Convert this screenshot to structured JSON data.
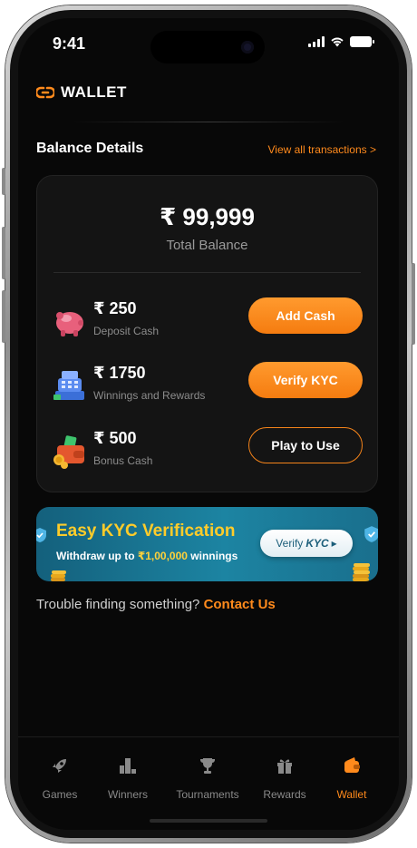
{
  "status_bar": {
    "time": "9:41"
  },
  "header": {
    "title": "WALLET",
    "logo_icon": "link-logo-icon"
  },
  "balance": {
    "section_title": "Balance Details",
    "view_all_link": "View all transactions >",
    "total_amount": "₹ 99,999",
    "total_label": "Total Balance",
    "rows": [
      {
        "amount": "₹ 250",
        "label": "Deposit Cash",
        "button": "Add Cash",
        "icon": "piggy-bank-icon"
      },
      {
        "amount": "₹ 1750",
        "label": "Winnings and Rewards",
        "button": "Verify KYC",
        "icon": "cash-register-icon"
      },
      {
        "amount": "₹ 500",
        "label": "Bonus Cash",
        "button": "Play to Use",
        "icon": "wallet-coins-icon"
      }
    ]
  },
  "banner": {
    "title": "Easy KYC Verification",
    "subtitle_prefix": "Withdraw up to ",
    "subtitle_amount": "₹1,00,000",
    "subtitle_suffix": " winnings",
    "button_prefix": "Verify",
    "button_emphasis": "KYC",
    "button_arrow": "▸"
  },
  "help": {
    "text": "Trouble finding something?",
    "link": "Contact Us"
  },
  "nav": {
    "items": [
      {
        "label": "Games",
        "icon": "rocket-icon"
      },
      {
        "label": "Winners",
        "icon": "podium-icon"
      },
      {
        "label": "Tournaments",
        "icon": "trophy-icon"
      },
      {
        "label": "Rewards",
        "icon": "gift-icon"
      },
      {
        "label": "Wallet",
        "icon": "wallet-icon"
      }
    ],
    "active": "Wallet"
  },
  "colors": {
    "accent": "#ff8a1c",
    "background": "#080808",
    "card": "#141414",
    "banner": "#1c84a2"
  }
}
